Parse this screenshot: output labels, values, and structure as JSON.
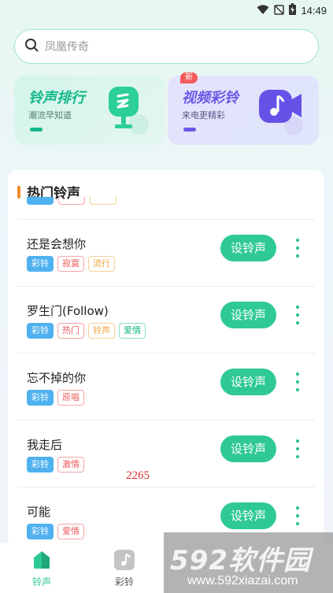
{
  "status": {
    "time": "14:49"
  },
  "search": {
    "placeholder": "凤凰传奇"
  },
  "cards": [
    {
      "title": "铃声排行",
      "subtitle": "潮流早知道"
    },
    {
      "title": "视频彩铃",
      "subtitle": "来电更精彩",
      "badge": "新"
    }
  ],
  "section": {
    "title": "热门铃声"
  },
  "songs": [
    {
      "title": "还是会想你",
      "tags": [
        "彩铃",
        "寂寞",
        "流行"
      ],
      "button": "设铃声"
    },
    {
      "title": "罗生门(Follow)",
      "tags": [
        "彩铃",
        "热门",
        "铃声",
        "爱情"
      ],
      "button": "设铃声"
    },
    {
      "title": "忘不掉的你",
      "tags": [
        "彩铃",
        "原唱"
      ],
      "button": "设铃声"
    },
    {
      "title": "我走后",
      "tags": [
        "彩铃",
        "激情"
      ],
      "button": "设铃声"
    },
    {
      "title": "可能",
      "tags": [
        "彩铃",
        "爱情"
      ],
      "button": "设铃声"
    }
  ],
  "watermark_number": "2265",
  "tabbar": [
    {
      "label": "铃声",
      "icon": "home-icon",
      "active": true
    },
    {
      "label": "彩铃",
      "icon": "music-note-icon",
      "active": false
    }
  ],
  "logo": {
    "main": "592软件园",
    "url": "www.592xiazai.com"
  },
  "colors": {
    "accent": "#2fc995",
    "card_left_title": "#13b889",
    "card_right_title": "#6a57e6",
    "section_bar": "#f08a2c",
    "tag_blue": "#4fb1ef",
    "tag_red": "#ef5b5b",
    "tag_orange": "#f2a33a",
    "tag_green": "#17b47f"
  }
}
